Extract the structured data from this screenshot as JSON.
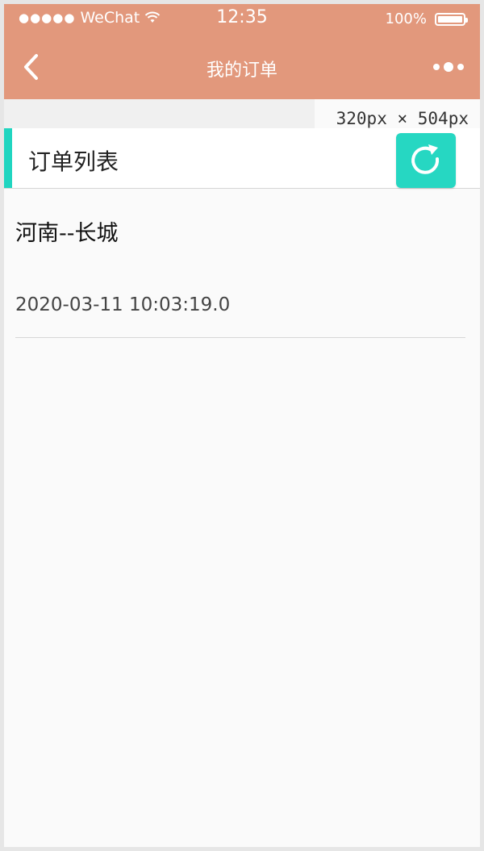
{
  "status_bar": {
    "signal_dots": "●●●●●",
    "carrier": "WeChat",
    "time": "12:35",
    "battery": "100%"
  },
  "nav": {
    "title": "我的订单",
    "back_icon": "chevron-left-icon",
    "more_icon": "more-dots-icon"
  },
  "overlay": {
    "dimensions": "320px × 504px"
  },
  "list": {
    "title": "订单列表",
    "refresh_icon": "refresh-icon"
  },
  "orders": [
    {
      "name": "河南--长城",
      "time": "2020-03-11 10:03:19.0"
    }
  ],
  "colors": {
    "header_bg": "#e2987c",
    "accent": "#20d5c0",
    "refresh_bg": "#26d7c2",
    "page_bg": "#fafafa"
  }
}
